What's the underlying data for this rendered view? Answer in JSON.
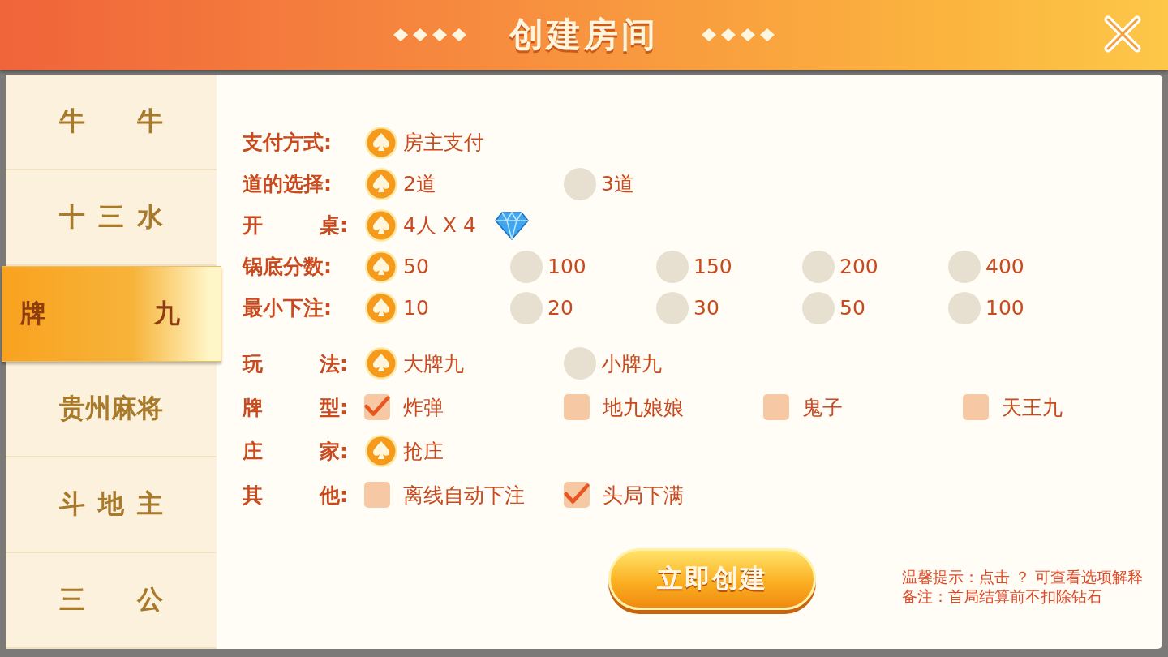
{
  "header": {
    "title": "创建房间"
  },
  "tabs": [
    {
      "label": "牛 牛",
      "selected": false
    },
    {
      "label": "十 三 水",
      "selected": false
    },
    {
      "label": "牌 九",
      "selected": true
    },
    {
      "label": "贵州麻将",
      "selected": false
    },
    {
      "label": "斗 地 主",
      "selected": false
    },
    {
      "label": "三 公",
      "selected": false
    }
  ],
  "settings": [
    {
      "label": "支付方式:",
      "options": [
        {
          "kind": "radio",
          "text": "房主支付",
          "selected": true
        }
      ]
    },
    {
      "label": "道的选择:",
      "options": [
        {
          "kind": "radio",
          "text": "2道",
          "selected": true
        },
        {
          "kind": "radio",
          "text": "3道",
          "selected": false
        }
      ]
    },
    {
      "label": "开 桌:",
      "options": [
        {
          "kind": "radio",
          "text": "4人 X 4",
          "selected": true,
          "gem": true
        }
      ]
    },
    {
      "label": "锅底分数:",
      "options": [
        {
          "kind": "radio",
          "text": "50",
          "selected": true
        },
        {
          "kind": "radio",
          "text": "100",
          "selected": false
        },
        {
          "kind": "radio",
          "text": "150",
          "selected": false
        },
        {
          "kind": "radio",
          "text": "200",
          "selected": false
        },
        {
          "kind": "radio",
          "text": "400",
          "selected": false
        }
      ]
    },
    {
      "label": "最小下注:",
      "options": [
        {
          "kind": "radio",
          "text": "10",
          "selected": true
        },
        {
          "kind": "radio",
          "text": "20",
          "selected": false
        },
        {
          "kind": "radio",
          "text": "30",
          "selected": false
        },
        {
          "kind": "radio",
          "text": "50",
          "selected": false
        },
        {
          "kind": "radio",
          "text": "100",
          "selected": false
        }
      ]
    },
    {
      "label": "玩 法:",
      "options": [
        {
          "kind": "radio",
          "text": "大牌九",
          "selected": true
        },
        {
          "kind": "radio",
          "text": "小牌九",
          "selected": false
        }
      ]
    },
    {
      "label": "牌 型:",
      "options": [
        {
          "kind": "checkbox",
          "text": "炸弹",
          "checked": true
        },
        {
          "kind": "checkbox",
          "text": "地九娘娘",
          "checked": false
        },
        {
          "kind": "checkbox",
          "text": "鬼子",
          "checked": false
        },
        {
          "kind": "checkbox",
          "text": "天王九",
          "checked": false
        }
      ]
    },
    {
      "label": "庄 家:",
      "options": [
        {
          "kind": "radio",
          "text": "抢庄",
          "selected": true
        }
      ]
    },
    {
      "label": "其 他:",
      "options": [
        {
          "kind": "checkbox",
          "text": "离线自动下注",
          "checked": false
        },
        {
          "kind": "checkbox",
          "text": "头局下满",
          "checked": true
        }
      ]
    }
  ],
  "create_button": "立即创建",
  "notes": [
    "温馨提示：点击 ？ 可查看选项解释",
    "备注：首局结算前不扣除钻石"
  ]
}
